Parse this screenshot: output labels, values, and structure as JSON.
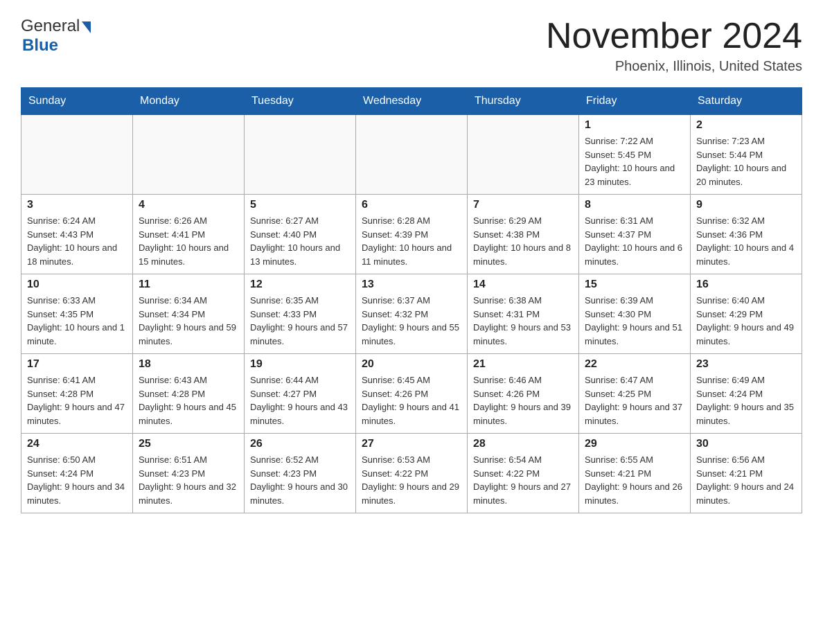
{
  "logo": {
    "general": "General",
    "blue": "Blue",
    "arrow_color": "#1a5fa8"
  },
  "title": "November 2024",
  "subtitle": "Phoenix, Illinois, United States",
  "weekdays": [
    "Sunday",
    "Monday",
    "Tuesday",
    "Wednesday",
    "Thursday",
    "Friday",
    "Saturday"
  ],
  "weeks": [
    [
      {
        "day": "",
        "info": ""
      },
      {
        "day": "",
        "info": ""
      },
      {
        "day": "",
        "info": ""
      },
      {
        "day": "",
        "info": ""
      },
      {
        "day": "",
        "info": ""
      },
      {
        "day": "1",
        "info": "Sunrise: 7:22 AM\nSunset: 5:45 PM\nDaylight: 10 hours and 23 minutes."
      },
      {
        "day": "2",
        "info": "Sunrise: 7:23 AM\nSunset: 5:44 PM\nDaylight: 10 hours and 20 minutes."
      }
    ],
    [
      {
        "day": "3",
        "info": "Sunrise: 6:24 AM\nSunset: 4:43 PM\nDaylight: 10 hours and 18 minutes."
      },
      {
        "day": "4",
        "info": "Sunrise: 6:26 AM\nSunset: 4:41 PM\nDaylight: 10 hours and 15 minutes."
      },
      {
        "day": "5",
        "info": "Sunrise: 6:27 AM\nSunset: 4:40 PM\nDaylight: 10 hours and 13 minutes."
      },
      {
        "day": "6",
        "info": "Sunrise: 6:28 AM\nSunset: 4:39 PM\nDaylight: 10 hours and 11 minutes."
      },
      {
        "day": "7",
        "info": "Sunrise: 6:29 AM\nSunset: 4:38 PM\nDaylight: 10 hours and 8 minutes."
      },
      {
        "day": "8",
        "info": "Sunrise: 6:31 AM\nSunset: 4:37 PM\nDaylight: 10 hours and 6 minutes."
      },
      {
        "day": "9",
        "info": "Sunrise: 6:32 AM\nSunset: 4:36 PM\nDaylight: 10 hours and 4 minutes."
      }
    ],
    [
      {
        "day": "10",
        "info": "Sunrise: 6:33 AM\nSunset: 4:35 PM\nDaylight: 10 hours and 1 minute."
      },
      {
        "day": "11",
        "info": "Sunrise: 6:34 AM\nSunset: 4:34 PM\nDaylight: 9 hours and 59 minutes."
      },
      {
        "day": "12",
        "info": "Sunrise: 6:35 AM\nSunset: 4:33 PM\nDaylight: 9 hours and 57 minutes."
      },
      {
        "day": "13",
        "info": "Sunrise: 6:37 AM\nSunset: 4:32 PM\nDaylight: 9 hours and 55 minutes."
      },
      {
        "day": "14",
        "info": "Sunrise: 6:38 AM\nSunset: 4:31 PM\nDaylight: 9 hours and 53 minutes."
      },
      {
        "day": "15",
        "info": "Sunrise: 6:39 AM\nSunset: 4:30 PM\nDaylight: 9 hours and 51 minutes."
      },
      {
        "day": "16",
        "info": "Sunrise: 6:40 AM\nSunset: 4:29 PM\nDaylight: 9 hours and 49 minutes."
      }
    ],
    [
      {
        "day": "17",
        "info": "Sunrise: 6:41 AM\nSunset: 4:28 PM\nDaylight: 9 hours and 47 minutes."
      },
      {
        "day": "18",
        "info": "Sunrise: 6:43 AM\nSunset: 4:28 PM\nDaylight: 9 hours and 45 minutes."
      },
      {
        "day": "19",
        "info": "Sunrise: 6:44 AM\nSunset: 4:27 PM\nDaylight: 9 hours and 43 minutes."
      },
      {
        "day": "20",
        "info": "Sunrise: 6:45 AM\nSunset: 4:26 PM\nDaylight: 9 hours and 41 minutes."
      },
      {
        "day": "21",
        "info": "Sunrise: 6:46 AM\nSunset: 4:26 PM\nDaylight: 9 hours and 39 minutes."
      },
      {
        "day": "22",
        "info": "Sunrise: 6:47 AM\nSunset: 4:25 PM\nDaylight: 9 hours and 37 minutes."
      },
      {
        "day": "23",
        "info": "Sunrise: 6:49 AM\nSunset: 4:24 PM\nDaylight: 9 hours and 35 minutes."
      }
    ],
    [
      {
        "day": "24",
        "info": "Sunrise: 6:50 AM\nSunset: 4:24 PM\nDaylight: 9 hours and 34 minutes."
      },
      {
        "day": "25",
        "info": "Sunrise: 6:51 AM\nSunset: 4:23 PM\nDaylight: 9 hours and 32 minutes."
      },
      {
        "day": "26",
        "info": "Sunrise: 6:52 AM\nSunset: 4:23 PM\nDaylight: 9 hours and 30 minutes."
      },
      {
        "day": "27",
        "info": "Sunrise: 6:53 AM\nSunset: 4:22 PM\nDaylight: 9 hours and 29 minutes."
      },
      {
        "day": "28",
        "info": "Sunrise: 6:54 AM\nSunset: 4:22 PM\nDaylight: 9 hours and 27 minutes."
      },
      {
        "day": "29",
        "info": "Sunrise: 6:55 AM\nSunset: 4:21 PM\nDaylight: 9 hours and 26 minutes."
      },
      {
        "day": "30",
        "info": "Sunrise: 6:56 AM\nSunset: 4:21 PM\nDaylight: 9 hours and 24 minutes."
      }
    ]
  ]
}
